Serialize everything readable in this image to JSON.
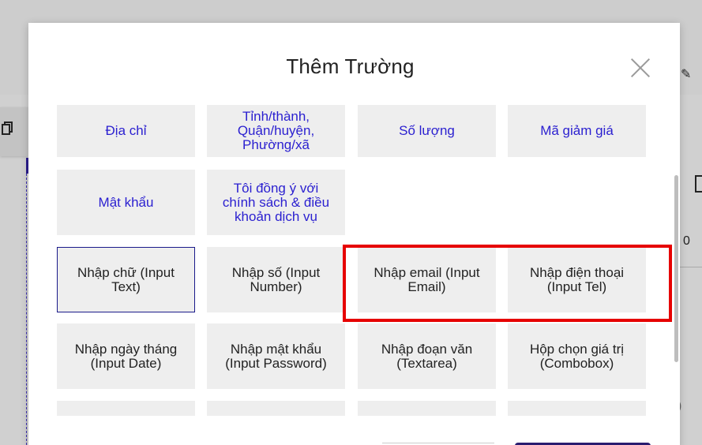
{
  "modal": {
    "title": "Thêm Trường",
    "close_label": "×"
  },
  "fields": [
    {
      "label": "Địa chỉ",
      "style": "blue"
    },
    {
      "label": "Tỉnh/thành, Quận/huyện, Phường/xã",
      "style": "blue"
    },
    {
      "label": "Số lượng",
      "style": "blue"
    },
    {
      "label": "Mã giảm giá",
      "style": "blue"
    },
    {
      "label": "Mật khẩu",
      "style": "blue"
    },
    {
      "label": "Tôi đồng ý với chính sách & điều khoản dịch vụ",
      "style": "blue"
    },
    {
      "label": "Nhập chữ (Input Text)",
      "style": "dark"
    },
    {
      "label": "Nhập số (Input Number)",
      "style": "dark"
    },
    {
      "label": "Nhập email (Input Email)",
      "style": "dark"
    },
    {
      "label": "Nhập điện thoại (Input Tel)",
      "style": "dark"
    },
    {
      "label": "Nhập ngày tháng (Input Date)",
      "style": "dark"
    },
    {
      "label": "Nhập mật khẩu (Input Password)",
      "style": "dark"
    },
    {
      "label": "Nhập đoạn văn (Textarea)",
      "style": "dark"
    },
    {
      "label": "Hộp chọn giá trị (Combobox)",
      "style": "dark"
    }
  ],
  "background": {
    "right_value": "0",
    "right_paren": ")"
  },
  "colors": {
    "link_blue": "#2a1fd0",
    "highlight_red": "#e60000",
    "tile_bg": "#eeeeee"
  }
}
